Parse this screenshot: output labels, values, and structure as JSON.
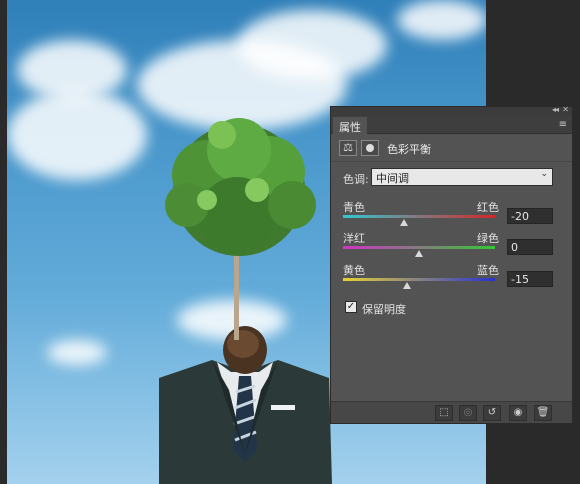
{
  "panel": {
    "tab_label": "属性",
    "collapse_glyph": "◂◂",
    "close_glyph": "✕",
    "menu_glyph": "≡",
    "adjustment_title": "色彩平衡",
    "adjustment_icon": "balance-icon",
    "mask_icon": "mask-icon"
  },
  "tone": {
    "label": "色调:",
    "value": "中间调",
    "arrow": "⌄"
  },
  "sliders": [
    {
      "left_label": "青色",
      "right_label": "红色",
      "value": "-20",
      "position": 0.4,
      "gradient": [
        "#32c8d2",
        "#d22828"
      ]
    },
    {
      "left_label": "洋红",
      "right_label": "绿色",
      "value": "0",
      "position": 0.5,
      "gradient": [
        "#d232c8",
        "#32c832"
      ]
    },
    {
      "left_label": "黄色",
      "right_label": "蓝色",
      "value": "-15",
      "position": 0.42,
      "gradient": [
        "#e6d232",
        "#2832d2"
      ]
    }
  ],
  "preserve": {
    "label": "保留明度",
    "checked": true,
    "check_glyph": "✓"
  },
  "bottom_bar": {
    "buttons": [
      {
        "name": "clip-to-layer-icon",
        "glyph": "⬚",
        "dim": false
      },
      {
        "name": "view-previous-icon",
        "glyph": "◎",
        "dim": true
      },
      {
        "name": "reset-icon",
        "glyph": "↺",
        "dim": false
      },
      {
        "name": "visibility-icon",
        "glyph": "◉",
        "dim": false
      },
      {
        "name": "trash-icon",
        "glyph": "🗑",
        "dim": false
      }
    ]
  },
  "colors": {
    "panel_bg": "#535353",
    "sky_top": "#2f7fb9",
    "sky_bottom": "#a4d1ed"
  }
}
